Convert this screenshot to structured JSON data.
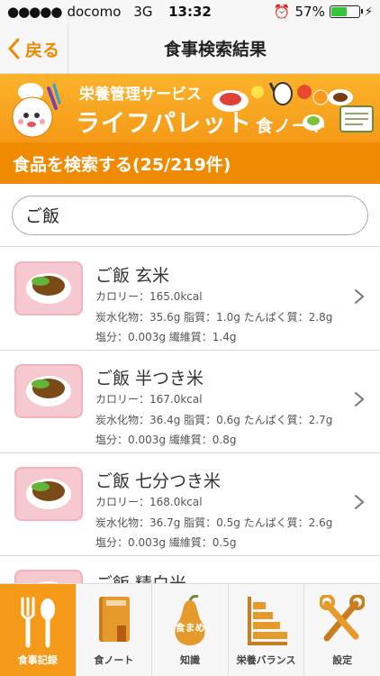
{
  "status_bar": {
    "carrier": "docomo",
    "network": "3G",
    "time": "13:32",
    "battery": "57%"
  },
  "nav": {
    "back_label": "戻る",
    "title": "食事検索結果"
  },
  "banner": {
    "subtitle": "栄養管理サービス",
    "title": "ライフパレット",
    "title_suffix": "食ノート"
  },
  "search": {
    "header": "食品を検索する(25/219件)",
    "value": "ご飯"
  },
  "results": [
    {
      "name": "ご飯 玄米",
      "calorie": "カロリー：165.0kcal",
      "macros": "炭水化物：35.6g 脂質：1.0g たんぱく質：2.8g",
      "minerals": "塩分：0.003g 繊維質：1.4g"
    },
    {
      "name": "ご飯 半つき米",
      "calorie": "カロリー：167.0kcal",
      "macros": "炭水化物：36.4g 脂質：0.6g たんぱく質：2.7g",
      "minerals": "塩分：0.003g 繊維質：0.8g"
    },
    {
      "name": "ご飯 七分つき米",
      "calorie": "カロリー：168.0kcal",
      "macros": "炭水化物：36.7g 脂質：0.5g たんぱく質：2.6g",
      "minerals": "塩分：0.003g 繊維質：0.5g"
    },
    {
      "name": "ご飯 精白米"
    }
  ],
  "tabs": [
    {
      "label": "食事記録",
      "icon": "fork-spoon-icon"
    },
    {
      "label": "食ノート",
      "icon": "notebook-icon"
    },
    {
      "label": "知識",
      "icon": "pear-icon",
      "icon_text": "食まめ"
    },
    {
      "label": "栄養バランス",
      "icon": "bar-chart-icon"
    },
    {
      "label": "設定",
      "icon": "tools-icon"
    }
  ],
  "colors": {
    "accent": "#f08a00",
    "banner": "#f59a18",
    "thumb_bg": "#f6c8cf"
  }
}
